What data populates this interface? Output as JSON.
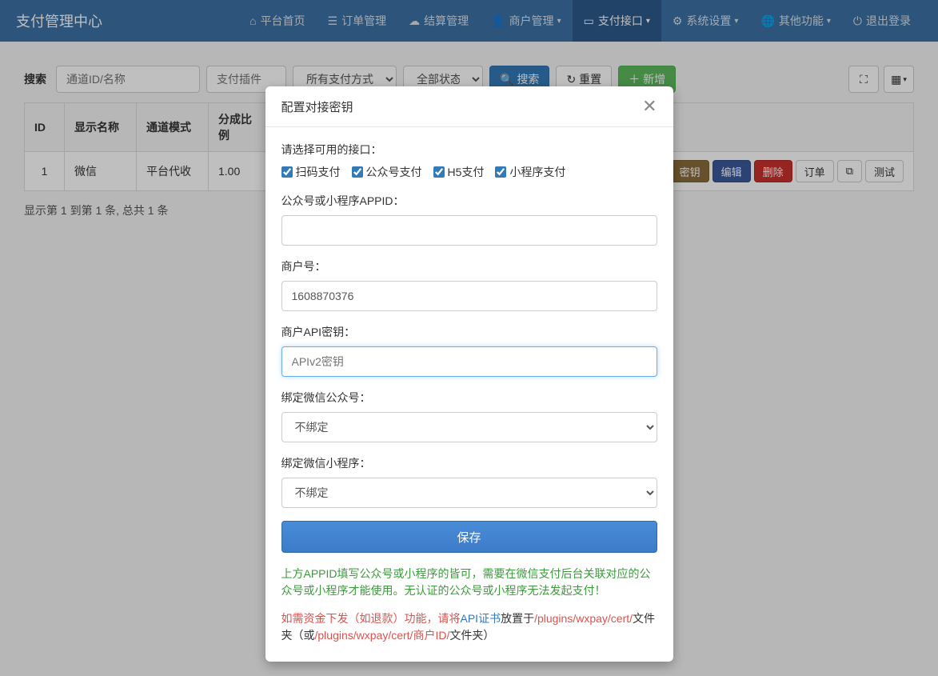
{
  "navbar": {
    "brand": "支付管理中心",
    "items": [
      {
        "label": "平台首页",
        "icon": "home"
      },
      {
        "label": "订单管理",
        "icon": "list"
      },
      {
        "label": "结算管理",
        "icon": "cloud"
      },
      {
        "label": "商户管理",
        "icon": "user",
        "caret": true
      },
      {
        "label": "支付接口",
        "icon": "card",
        "caret": true,
        "active": true
      },
      {
        "label": "系统设置",
        "icon": "gear",
        "caret": true
      },
      {
        "label": "其他功能",
        "icon": "globe",
        "caret": true
      },
      {
        "label": "退出登录",
        "icon": "power"
      }
    ]
  },
  "filter": {
    "label": "搜索",
    "channel_placeholder": "通道ID/名称",
    "plugin_placeholder": "支付插件",
    "paymethod_selected": "所有支付方式",
    "status_selected": "全部状态",
    "search_btn": "搜索",
    "reset_btn": "重置",
    "add_btn": "新增"
  },
  "table": {
    "headers": [
      "ID",
      "显示名称",
      "通道模式",
      "分成比例"
    ],
    "rows": [
      {
        "id": "1",
        "name": "微信",
        "mode": "平台代收",
        "ratio": "1.00"
      }
    ],
    "row_actions": {
      "key": "密钥",
      "edit": "编辑",
      "delete": "删除",
      "order": "订单",
      "copy_icon": "⧉",
      "test": "测试"
    }
  },
  "pagination": "显示第 1 到第 1 条, 总共 1 条",
  "modal": {
    "title": "配置对接密钥",
    "label_interface": "请选择可用的接口：",
    "checkboxes": [
      {
        "label": "扫码支付",
        "checked": true
      },
      {
        "label": "公众号支付",
        "checked": true
      },
      {
        "label": "H5支付",
        "checked": true
      },
      {
        "label": "小程序支付",
        "checked": true
      }
    ],
    "label_appid": "公众号或小程序APPID：",
    "appid_value": "",
    "label_mchid": "商户号：",
    "mchid_value": "1608870376",
    "label_apikey": "商户API密钥：",
    "apikey_placeholder": "APIv2密钥",
    "label_bind_mp": "绑定微信公众号：",
    "bind_mp_selected": "不绑定",
    "label_bind_mini": "绑定微信小程序：",
    "bind_mini_selected": "不绑定",
    "save_btn": "保存",
    "help1": "上方APPID填写公众号或小程序的皆可，需要在微信支付后台关联对应的公众号或小程序才能使用。无认证的公众号或小程序无法发起支付！",
    "help2_prefix": "如需资金下发（如退款）功能，请将",
    "help2_link": "API证书",
    "help2_mid1": "放置于",
    "help2_path1": "/plugins/wxpay/cert/",
    "help2_mid2": "文件夹（或",
    "help2_path2": "/plugins/wxpay/cert/商户ID/",
    "help2_suffix": "文件夹）"
  }
}
